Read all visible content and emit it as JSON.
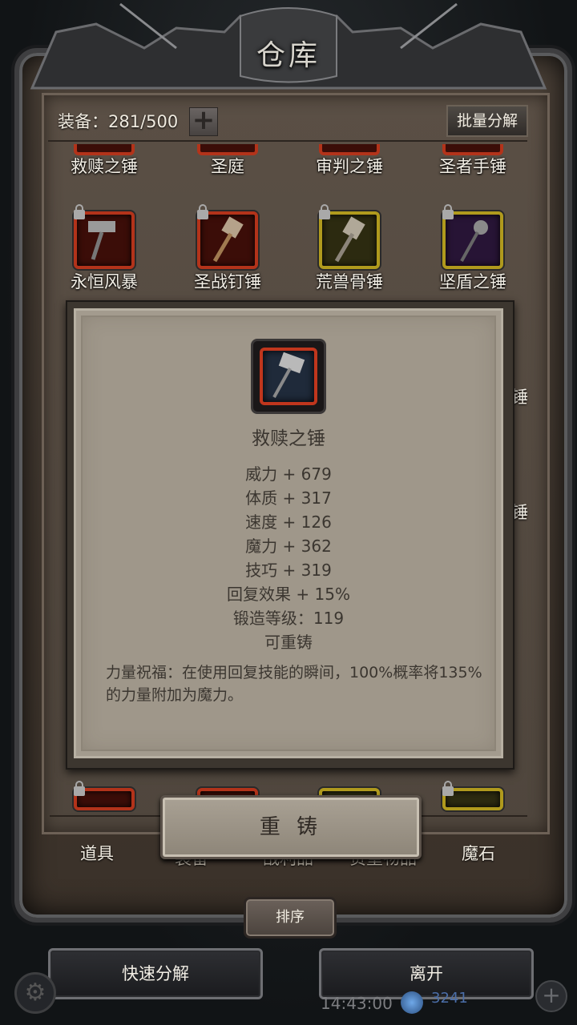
{
  "window": {
    "title": "仓库"
  },
  "header": {
    "equip_label": "装备：281/500",
    "batch_label": "批量分解"
  },
  "grid": {
    "row1": [
      "救赎之锤",
      "圣庭",
      "审判之锤",
      "圣者手锤"
    ],
    "row2": [
      "永恒风暴",
      "圣战钉锤",
      "荒兽骨锤",
      "坚盾之锤"
    ],
    "side_right": [
      "锤",
      "锤"
    ]
  },
  "popup": {
    "name": "救赎之锤",
    "stats": [
      "威力 + 679",
      "体质 + 317",
      "速度 + 126",
      "魔力 + 362",
      "技巧 + 319",
      "回复效果 + 15%",
      "锻造等级：119",
      "可重铸"
    ],
    "desc": "力量祝福：在使用回复技能的瞬间，100%概率将135%的力量附加为魔力。",
    "reforge_label": "重 铸"
  },
  "tabs": [
    "道具",
    "装备",
    "战利品",
    "贵重物品",
    "魔石"
  ],
  "sort_label": "排序",
  "bottom": {
    "quick_label": "快速分解",
    "leave_label": "离开",
    "time": "14:43:00",
    "gems": "3241"
  },
  "colors": {
    "rare_red": "#b3331a",
    "epic_gold": "#b09a1d",
    "panel": "#9f978a"
  }
}
